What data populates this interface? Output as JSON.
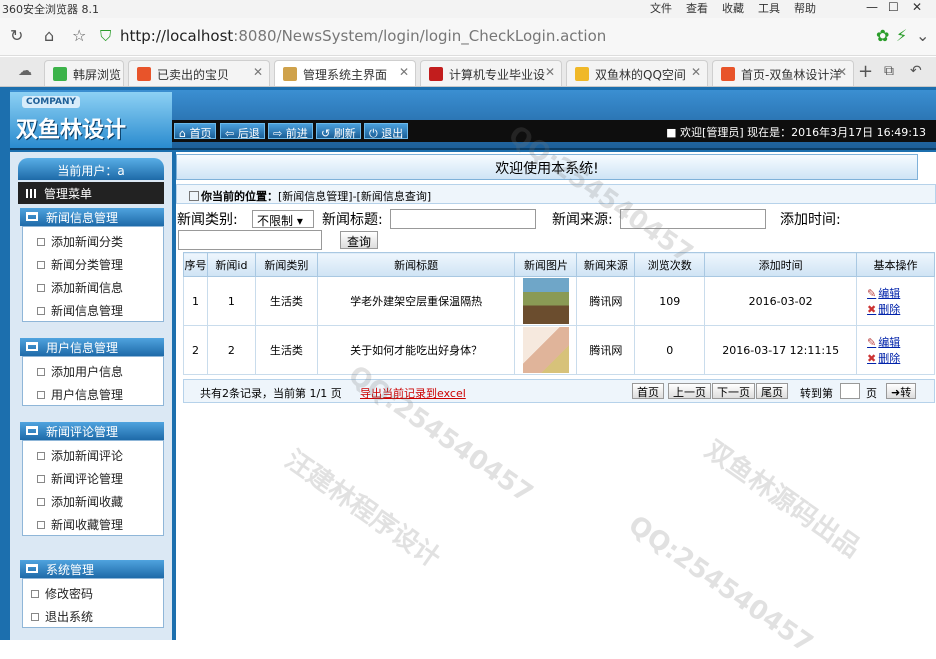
{
  "browser": {
    "title": "360安全浏览器 8.1",
    "menus": [
      "文件",
      "查看",
      "收藏",
      "工具",
      "帮助"
    ],
    "url_host": "http://localhost",
    "url_path": ":8080/NewsSystem/login/login_CheckLogin.action",
    "tabs": [
      {
        "label": "韩屏浏览",
        "color": "#3cb34a"
      },
      {
        "label": "已卖出的宝贝",
        "color": "#e8542a"
      },
      {
        "label": "管理系统主界面",
        "color": "#cfa24b"
      },
      {
        "label": "计算机专业毕业设",
        "color": "#c21d1d"
      },
      {
        "label": "双鱼林的QQ空间",
        "color": "#f0b828"
      },
      {
        "label": "首页-双鱼林设计洋",
        "color": "#e8542a"
      }
    ]
  },
  "header": {
    "company": "COMPANY",
    "brand": "双鱼林设计",
    "toolbar": [
      "首页",
      "后退",
      "前进",
      "刷新",
      "退出"
    ],
    "welcome": "欢迎[管理员] 现在是：2016年3月17日 16:49:13"
  },
  "sidebar": {
    "current_user_label": "当前用户：a",
    "menu_title": "管理菜单",
    "panels": [
      {
        "title": "新闻信息管理",
        "items": [
          "添加新闻分类",
          "新闻分类管理",
          "添加新闻信息",
          "新闻信息管理"
        ]
      },
      {
        "title": "用户信息管理",
        "items": [
          "添加用户信息",
          "用户信息管理"
        ]
      },
      {
        "title": "新闻评论管理",
        "items": [
          "添加新闻评论",
          "新闻评论管理",
          "添加新闻收藏",
          "新闻收藏管理"
        ]
      },
      {
        "title": "系统管理",
        "items": [
          "修改密码",
          "退出系统"
        ]
      }
    ]
  },
  "main": {
    "welcome_title": "欢迎使用本系统!",
    "position_label": "你当前的位置：",
    "position_value": "[新闻信息管理]-[新闻信息查询]",
    "filters": {
      "category_label": "新闻类别:",
      "category_value": "不限制",
      "title_label": "新闻标题:",
      "source_label": "新闻来源:",
      "time_label": "添加时间:",
      "query_button": "查询"
    },
    "table": {
      "headers": [
        "序号",
        "新闻id",
        "新闻类别",
        "新闻标题",
        "新闻图片",
        "新闻来源",
        "浏览次数",
        "添加时间",
        "基本操作"
      ],
      "rows": [
        {
          "no": "1",
          "id": "1",
          "category": "生活类",
          "title": "学老外建架空层重保温隔热",
          "source": "腾讯网",
          "views": "109",
          "time": "2016-03-02"
        },
        {
          "no": "2",
          "id": "2",
          "category": "生活类",
          "title": "关于如何才能吃出好身体？",
          "source": "腾讯网",
          "views": "0",
          "time": "2016-03-17 12:11:15"
        }
      ],
      "edit_label": "编辑",
      "delete_label": "删除"
    },
    "pager": {
      "info": "共有2条记录，当前第 1/1 页",
      "export": "导出当前记录到excel",
      "buttons": [
        "首页",
        "上一页",
        "下一页",
        "尾页"
      ],
      "goto_label": "转到第",
      "page_unit": "页",
      "go": "转"
    }
  },
  "watermarks": [
    "汪建林程序设计",
    "QQ:254540457",
    "双鱼林源码出品"
  ]
}
